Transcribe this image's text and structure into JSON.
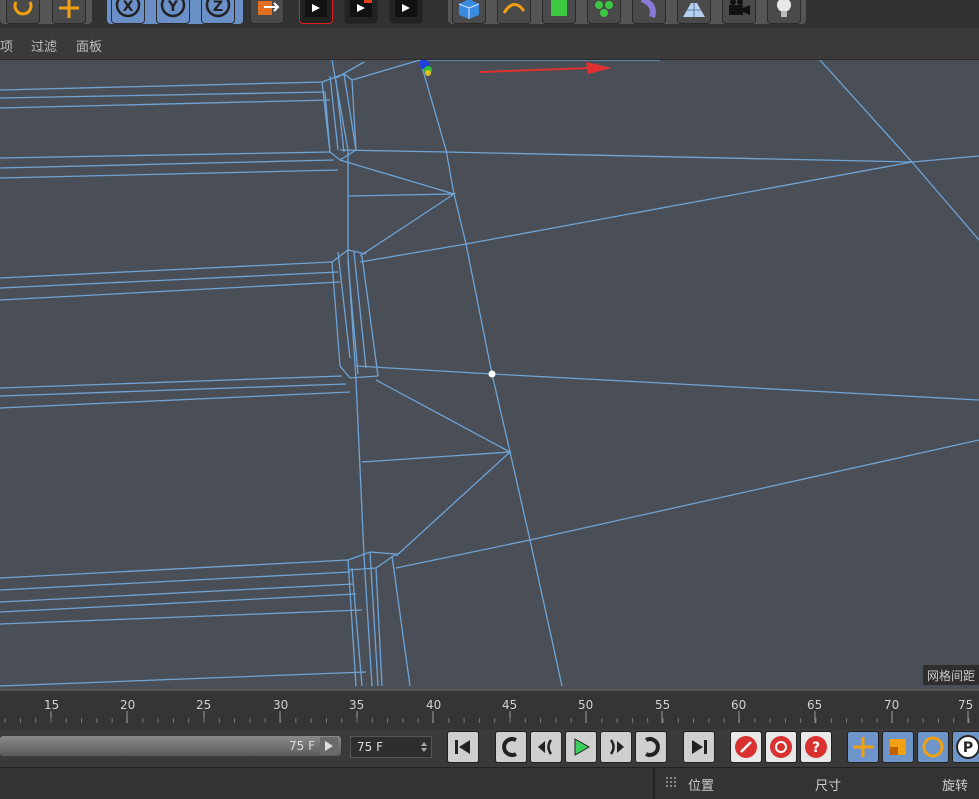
{
  "menu": [
    "项",
    "过滤",
    "面板"
  ],
  "viewport": {
    "grid_label": "网格间距"
  },
  "timeline": {
    "ticks": [
      "15",
      "20",
      "25",
      "30",
      "35",
      "40",
      "45",
      "50",
      "55",
      "60",
      "65",
      "70",
      "75"
    ]
  },
  "controls": {
    "range_end": "75 F",
    "frame_value": "75 F"
  },
  "attributes": {
    "position": "位置",
    "size": "尺寸",
    "rotation": "旋转"
  },
  "icons": {
    "toolbar": [
      "rotate-icon",
      "move-icon",
      "x-axis-icon",
      "y-axis-icon",
      "z-axis-icon",
      "world-coordinates-icon",
      "render-view-icon",
      "render-picture-queue-icon",
      "render-settings-icon",
      "cube-icon",
      "spline-pen-icon",
      "subdivision-icon",
      "cloner-icon",
      "deformer-icon",
      "floor-icon",
      "camera-icon",
      "light-icon"
    ],
    "playback": [
      "go-to-start-icon",
      "previous-key-icon",
      "step-back-icon",
      "play-icon",
      "step-forward-icon",
      "next-key-icon",
      "go-to-end-icon",
      "record-icon",
      "autokey-icon",
      "keyframe-selection-icon",
      "move-key-icon",
      "scale-key-icon",
      "rotate-key-icon",
      "param-key-icon"
    ]
  },
  "colors": {
    "viewport_bg": "#4a4f57",
    "wire": "#6ea3d6",
    "x_axis": "#e03030",
    "toolbar_bg": "#323232",
    "play": "#3ccf5c"
  }
}
